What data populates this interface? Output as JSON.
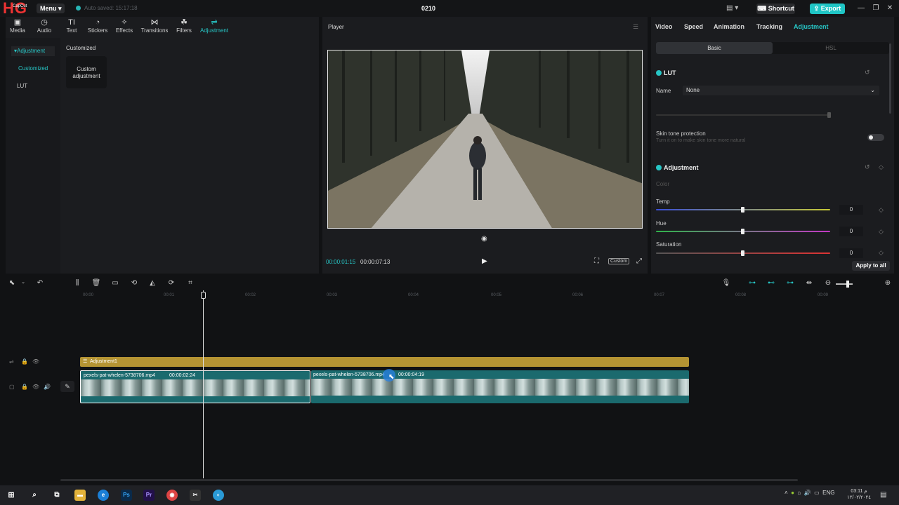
{
  "titlebar": {
    "menu": "Menu",
    "autosave": "Auto saved: 15:17:18",
    "project_title": "0210",
    "shortcut": "Shortcut",
    "export": "Export",
    "logo_text": "HG",
    "logo_small": "CapCut"
  },
  "toolbar": [
    {
      "label": "Media",
      "icon": "media-icon"
    },
    {
      "label": "Audio",
      "icon": "audio-icon"
    },
    {
      "label": "Text",
      "icon": "text-icon"
    },
    {
      "label": "Stickers",
      "icon": "sticker-icon"
    },
    {
      "label": "Effects",
      "icon": "effects-icon"
    },
    {
      "label": "Transitions",
      "icon": "transitions-icon"
    },
    {
      "label": "Filters",
      "icon": "filters-icon"
    },
    {
      "label": "Adjustment",
      "icon": "adjustment-icon"
    }
  ],
  "left_nav": {
    "header": "Adjustment",
    "items": [
      "Customized",
      "LUT"
    ]
  },
  "left_content": {
    "section": "Customized",
    "card_label": "Custom adjustment"
  },
  "player": {
    "title": "Player",
    "current_time": "00:00:01:15",
    "total_time": "00:00:07:13",
    "ratio": "Custom"
  },
  "inspector": {
    "tabs": [
      "Video",
      "Speed",
      "Animation",
      "Tracking",
      "Adjustment"
    ],
    "active_tab": "Adjustment",
    "segments": [
      "Basic",
      "HSL"
    ],
    "lut": {
      "title": "LUT",
      "name_label": "Name",
      "name_value": "None",
      "skin_label": "Skin tone protection",
      "skin_hint": "Turn it on to make skin tone more natural"
    },
    "adjustment": {
      "title": "Adjustment",
      "color_label": "Color",
      "sliders": [
        {
          "label": "Temp",
          "value": "0"
        },
        {
          "label": "Hue",
          "value": "0"
        },
        {
          "label": "Saturation",
          "value": "0"
        }
      ]
    },
    "apply_all": "Apply to all"
  },
  "timeline": {
    "ticks": [
      "00:00",
      "00:01",
      "00:02",
      "00:03",
      "00:04",
      "00:05",
      "00:06",
      "00:07",
      "00:08",
      "00:09"
    ],
    "adjustment_clip": "Adjustment1",
    "clip1": {
      "name": "pexels-pat-whelen-5738706.mp4",
      "duration": "00:00:02:24"
    },
    "clip2": {
      "name": "pexels-pat-whelen-5738706.mp4",
      "duration": "00:00:04:19"
    }
  },
  "taskbar": {
    "lang": "ENG",
    "time": "03:11 م",
    "date": "١٢/٠٢/٢٠٢٤"
  },
  "colors": {
    "accent": "#1fc5c5",
    "adjustment_track": "#b59433",
    "clip": "#1b6a6e"
  }
}
